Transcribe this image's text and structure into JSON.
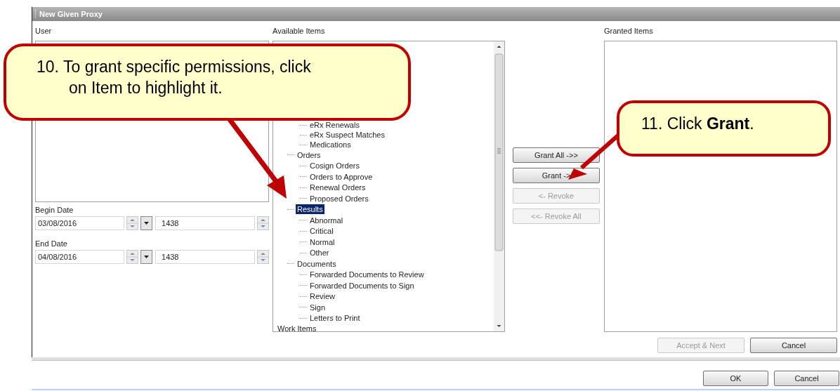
{
  "window": {
    "title": "New Given Proxy"
  },
  "user": {
    "label": "User"
  },
  "begin_date": {
    "label": "Begin Date",
    "date": "03/08/2016",
    "time": "1438"
  },
  "end_date": {
    "label": "End Date",
    "date": "04/08/2016",
    "time": "1438"
  },
  "available": {
    "label": "Available Items",
    "partial_children": [
      {
        "label": "eRx Renewals",
        "selected": false
      },
      {
        "label": "eRx Suspect Matches",
        "selected": false
      },
      {
        "label": "Medications",
        "selected": false
      }
    ],
    "groups": [
      {
        "label": "Orders",
        "selected": false,
        "children": [
          {
            "label": "Cosign Orders",
            "selected": false
          },
          {
            "label": "Orders to Approve",
            "selected": false
          },
          {
            "label": "Renewal Orders",
            "selected": false
          },
          {
            "label": "Proposed Orders",
            "selected": false
          }
        ]
      },
      {
        "label": "Results",
        "selected": true,
        "children": [
          {
            "label": "Abnormal",
            "selected": false
          },
          {
            "label": "Critical",
            "selected": false
          },
          {
            "label": "Normal",
            "selected": false
          },
          {
            "label": "Other",
            "selected": false
          }
        ]
      },
      {
        "label": "Documents",
        "selected": false,
        "children": [
          {
            "label": "Forwarded Documents to Review",
            "selected": false
          },
          {
            "label": "Forwarded Documents to Sign",
            "selected": false
          },
          {
            "label": "Review",
            "selected": false
          },
          {
            "label": "Sign",
            "selected": false
          },
          {
            "label": "Letters to Print",
            "selected": false
          }
        ]
      }
    ],
    "root_items": [
      {
        "label": "Work Items",
        "selected": false
      }
    ]
  },
  "transfer_buttons": [
    {
      "label": "Grant All ->>",
      "disabled": false
    },
    {
      "label": "Grant ->",
      "disabled": false
    },
    {
      "label": "<- Revoke",
      "disabled": true
    },
    {
      "label": "<<- Revoke All",
      "disabled": true
    }
  ],
  "granted": {
    "label": "Granted Items"
  },
  "panel_buttons": [
    {
      "label": "Accept & Next",
      "disabled": true
    },
    {
      "label": "Cancel",
      "disabled": false
    }
  ],
  "dialog_buttons": [
    {
      "label": "OK",
      "disabled": false
    },
    {
      "label": "Cancel",
      "disabled": false
    }
  ],
  "callouts": [
    {
      "text": "10. To grant specific permissions, click on Item to highlight it."
    },
    {
      "text": "11. Click **Grant**."
    }
  ]
}
